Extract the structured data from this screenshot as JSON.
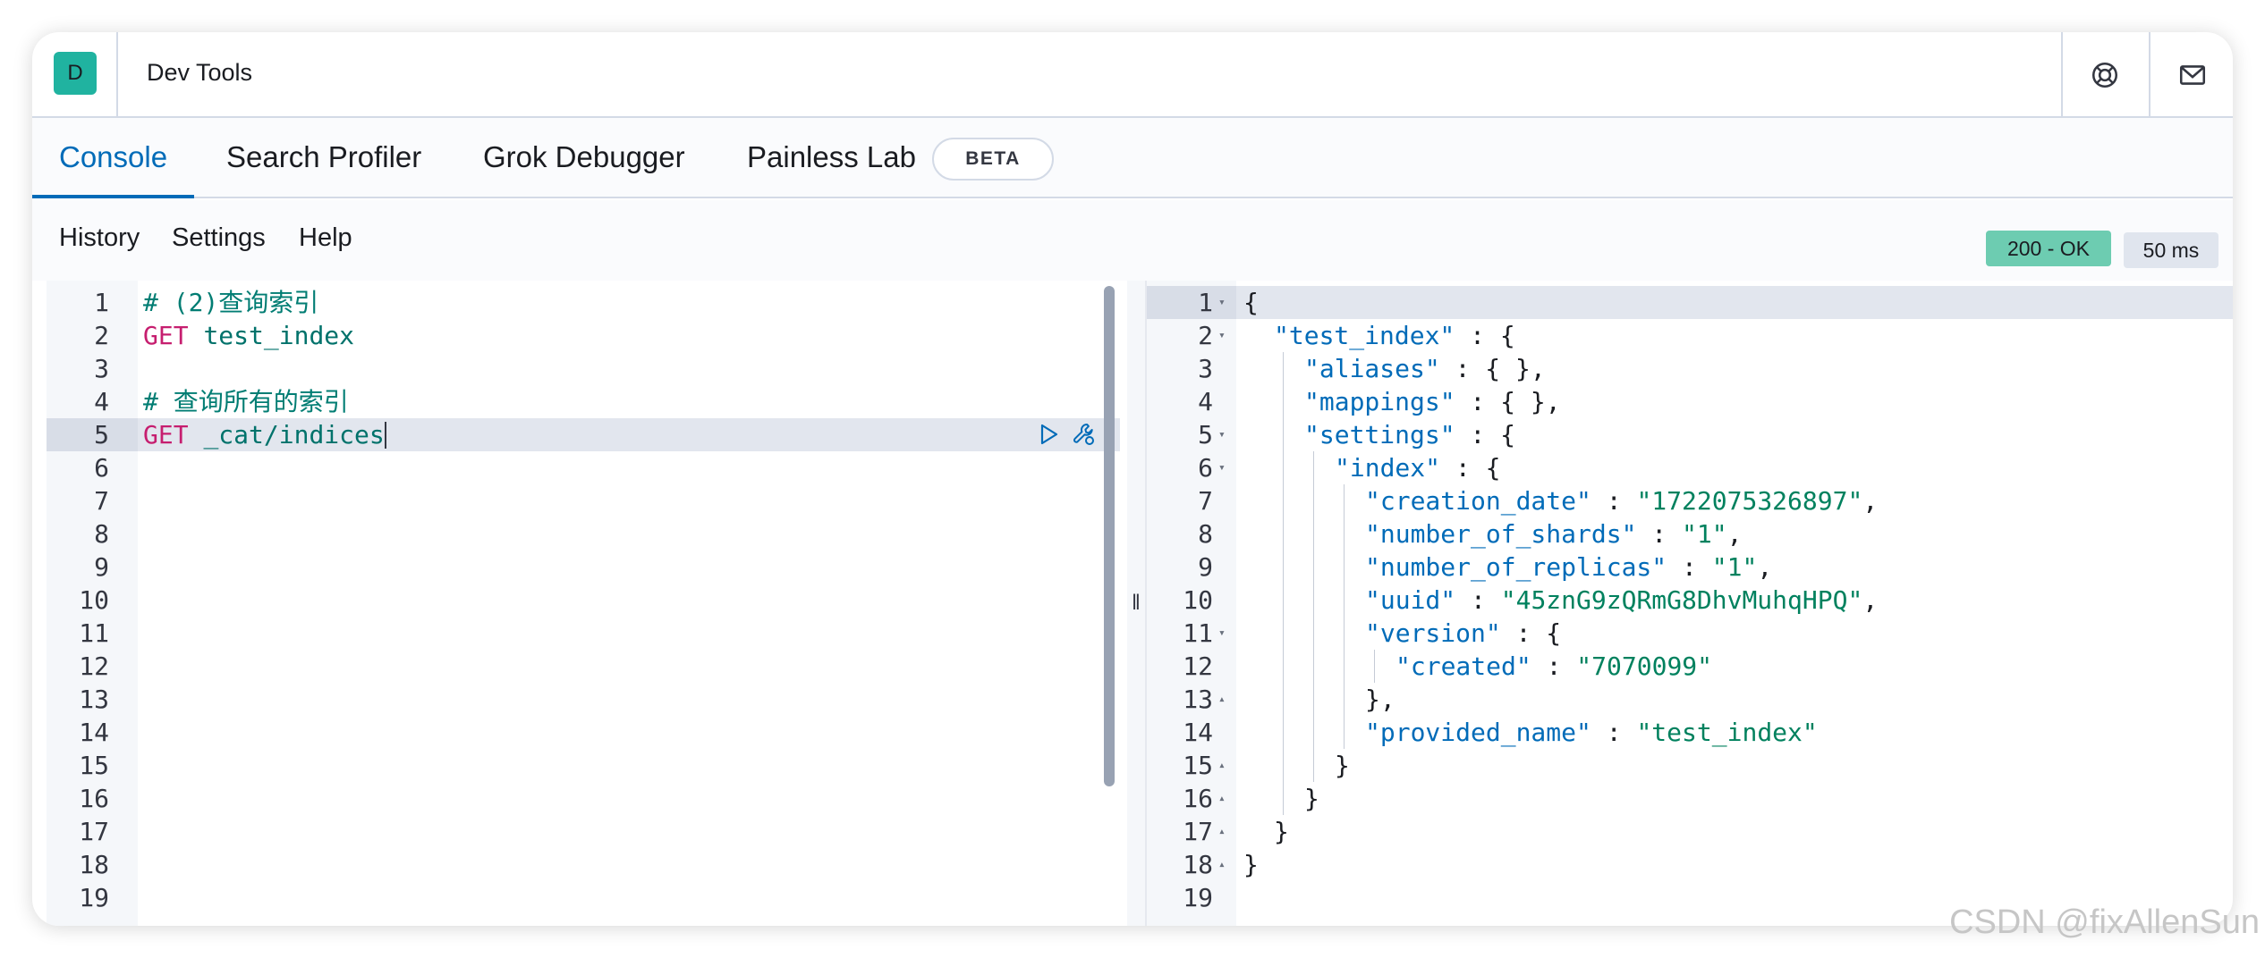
{
  "header": {
    "app_icon_letter": "D",
    "title": "Dev Tools",
    "help_icon": "help-lifebuoy-icon",
    "mail_icon": "mail-icon"
  },
  "tabs": [
    {
      "label": "Console",
      "active": true
    },
    {
      "label": "Search Profiler",
      "active": false
    },
    {
      "label": "Grok Debugger",
      "active": false
    },
    {
      "label": "Painless Lab",
      "active": false
    }
  ],
  "beta_badge": "BETA",
  "toolbar": {
    "history": "History",
    "settings": "Settings",
    "help": "Help",
    "status": "200 - OK",
    "duration": "50 ms"
  },
  "colors": {
    "accent": "#006bb8",
    "status_ok_bg": "#6dccb1",
    "method": "#c61e6f",
    "comment": "#017d73",
    "json_key": "#006bb8",
    "json_string": "#00815e"
  },
  "request_editor": {
    "active_line": 5,
    "lines": [
      {
        "n": "1",
        "text": "# (2)查询索引"
      },
      {
        "n": "2",
        "method": "GET",
        "url": "test_index"
      },
      {
        "n": "3",
        "text": ""
      },
      {
        "n": "4",
        "text": "# 查询所有的索引"
      },
      {
        "n": "5",
        "method": "GET",
        "url": "_cat/indices"
      },
      {
        "n": "6"
      },
      {
        "n": "7"
      },
      {
        "n": "8"
      },
      {
        "n": "9"
      },
      {
        "n": "10"
      },
      {
        "n": "11"
      },
      {
        "n": "12"
      },
      {
        "n": "13"
      },
      {
        "n": "14"
      },
      {
        "n": "15"
      },
      {
        "n": "16"
      },
      {
        "n": "17"
      },
      {
        "n": "18"
      },
      {
        "n": "19"
      }
    ]
  },
  "response_editor": {
    "lines": [
      {
        "n": "1",
        "fold": "▾",
        "parts": [
          [
            "punc",
            "{"
          ]
        ]
      },
      {
        "n": "2",
        "fold": "▾",
        "parts": [
          [
            "key",
            "\"test_index\""
          ],
          [
            "punc",
            " : {"
          ]
        ]
      },
      {
        "n": "3",
        "parts": [
          [
            "key",
            "\"aliases\""
          ],
          [
            "punc",
            " : { },"
          ]
        ]
      },
      {
        "n": "4",
        "parts": [
          [
            "key",
            "\"mappings\""
          ],
          [
            "punc",
            " : { },"
          ]
        ]
      },
      {
        "n": "5",
        "fold": "▾",
        "parts": [
          [
            "key",
            "\"settings\""
          ],
          [
            "punc",
            " : {"
          ]
        ]
      },
      {
        "n": "6",
        "fold": "▾",
        "parts": [
          [
            "key",
            "\"index\""
          ],
          [
            "punc",
            " : {"
          ]
        ]
      },
      {
        "n": "7",
        "parts": [
          [
            "key",
            "\"creation_date\""
          ],
          [
            "punc",
            " : "
          ],
          [
            "str",
            "\"1722075326897\""
          ],
          [
            "punc",
            ","
          ]
        ]
      },
      {
        "n": "8",
        "parts": [
          [
            "key",
            "\"number_of_shards\""
          ],
          [
            "punc",
            " : "
          ],
          [
            "str",
            "\"1\""
          ],
          [
            "punc",
            ","
          ]
        ]
      },
      {
        "n": "9",
        "parts": [
          [
            "key",
            "\"number_of_replicas\""
          ],
          [
            "punc",
            " : "
          ],
          [
            "str",
            "\"1\""
          ],
          [
            "punc",
            ","
          ]
        ]
      },
      {
        "n": "10",
        "parts": [
          [
            "key",
            "\"uuid\""
          ],
          [
            "punc",
            " : "
          ],
          [
            "str",
            "\"45znG9zQRmG8DhvMuhqHPQ\""
          ],
          [
            "punc",
            ","
          ]
        ]
      },
      {
        "n": "11",
        "fold": "▾",
        "parts": [
          [
            "key",
            "\"version\""
          ],
          [
            "punc",
            " : {"
          ]
        ]
      },
      {
        "n": "12",
        "parts": [
          [
            "key",
            "\"created\""
          ],
          [
            "punc",
            " : "
          ],
          [
            "str",
            "\"7070099\""
          ]
        ]
      },
      {
        "n": "13",
        "fold": "▴",
        "parts": [
          [
            "punc",
            "},"
          ]
        ]
      },
      {
        "n": "14",
        "parts": [
          [
            "key",
            "\"provided_name\""
          ],
          [
            "punc",
            " : "
          ],
          [
            "str",
            "\"test_index\""
          ]
        ]
      },
      {
        "n": "15",
        "fold": "▴",
        "parts": [
          [
            "punc",
            "}"
          ]
        ]
      },
      {
        "n": "16",
        "fold": "▴",
        "parts": [
          [
            "punc",
            "}"
          ]
        ]
      },
      {
        "n": "17",
        "fold": "▴",
        "parts": [
          [
            "punc",
            "}"
          ]
        ]
      },
      {
        "n": "18",
        "fold": "▴",
        "parts": [
          [
            "punc",
            "}"
          ]
        ]
      },
      {
        "n": "19",
        "parts": []
      }
    ]
  },
  "watermark": "CSDN @fixAllenSun"
}
